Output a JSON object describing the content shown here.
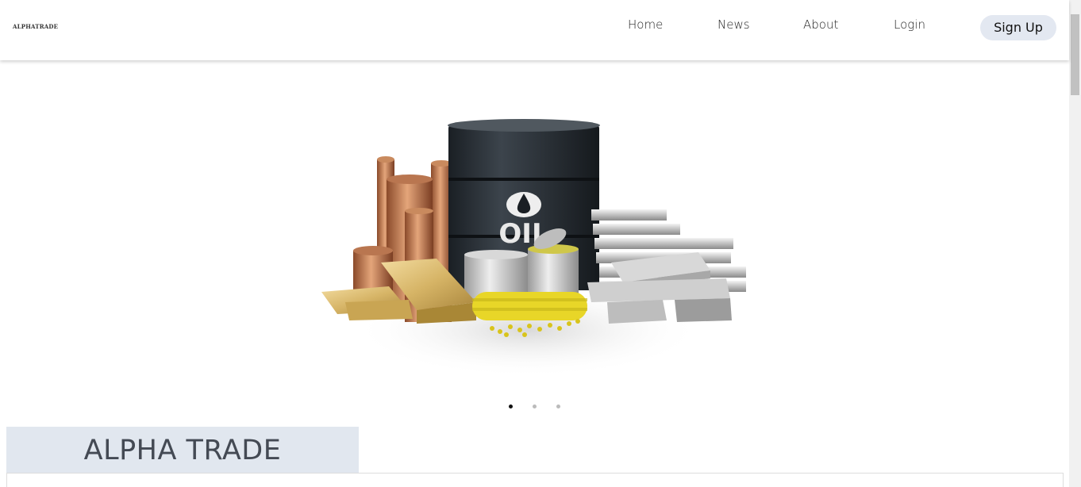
{
  "header": {
    "brand": "ALPHATRADE",
    "nav": {
      "home": "Home",
      "news": "News",
      "about": "About",
      "login": "Login"
    },
    "signup": "Sign Up"
  },
  "hero": {
    "barrel_label": "OIL",
    "slide_count": 3,
    "active_slide": 1
  },
  "section": {
    "title": "ALPHA TRADE"
  },
  "colors": {
    "signup_bg": "#e3e8f1",
    "title_bg": "#e1e7ef",
    "title_text": "#444a54"
  }
}
